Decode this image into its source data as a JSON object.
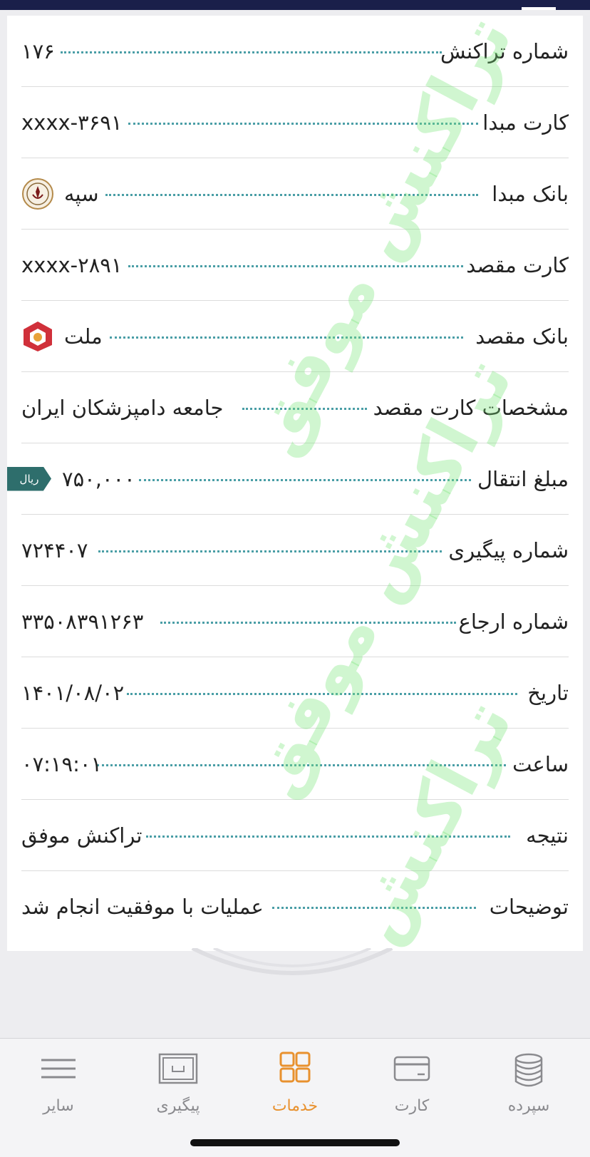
{
  "rows": [
    {
      "label": "شماره تراکنش",
      "value": "۱۷۶"
    },
    {
      "label": "کارت مبدا",
      "value": "xxxx-۳۶۹۱"
    },
    {
      "label": "بانک مبدا",
      "value": "سپه",
      "icon": "bank-sepah-logo-icon"
    },
    {
      "label": "کارت مقصد",
      "value": "xxxx-۲۸۹۱"
    },
    {
      "label": "بانک مقصد",
      "value": "ملت",
      "icon": "bank-mellat-logo-icon"
    },
    {
      "label": "مشخصات کارت مقصد",
      "value": "جامعه دامپزشکان ایران"
    },
    {
      "label": "مبلغ انتقال",
      "value": "۷۵۰,۰۰۰",
      "unit": "ریال"
    },
    {
      "label": "شماره پیگیری",
      "value": "۷۲۴۴۰۷"
    },
    {
      "label": "شماره ارجاع",
      "value": "۳۳۵۰۸۳۹۱۲۶۳"
    },
    {
      "label": "تاریخ",
      "value": "۱۴۰۱/۰۸/۰۲"
    },
    {
      "label": "ساعت",
      "value": "۰۷:۱۹:۰۱"
    },
    {
      "label": "نتیجه",
      "value": "تراکنش موفق"
    },
    {
      "label": "توضیحات",
      "value": "عملیات با موفقیت انجام شد"
    }
  ],
  "watermark": {
    "text": "تراکنش موفق"
  },
  "tabs": [
    {
      "label": "سپرده",
      "icon": "coins-stack-icon",
      "active": false
    },
    {
      "label": "کارت",
      "icon": "credit-card-icon",
      "active": false
    },
    {
      "label": "خدمات",
      "icon": "grid-services-icon",
      "active": true
    },
    {
      "label": "پیگیری",
      "icon": "tracking-box-icon",
      "active": false
    },
    {
      "label": "سایر",
      "icon": "menu-lines-icon",
      "active": false
    }
  ],
  "colors": {
    "header": "#1a1f4a",
    "accent": "#e8912e",
    "leader": "#4a9ea6",
    "badge": "#2e6e6c",
    "watermark": "#78e678",
    "mellat": "#d0303a"
  }
}
